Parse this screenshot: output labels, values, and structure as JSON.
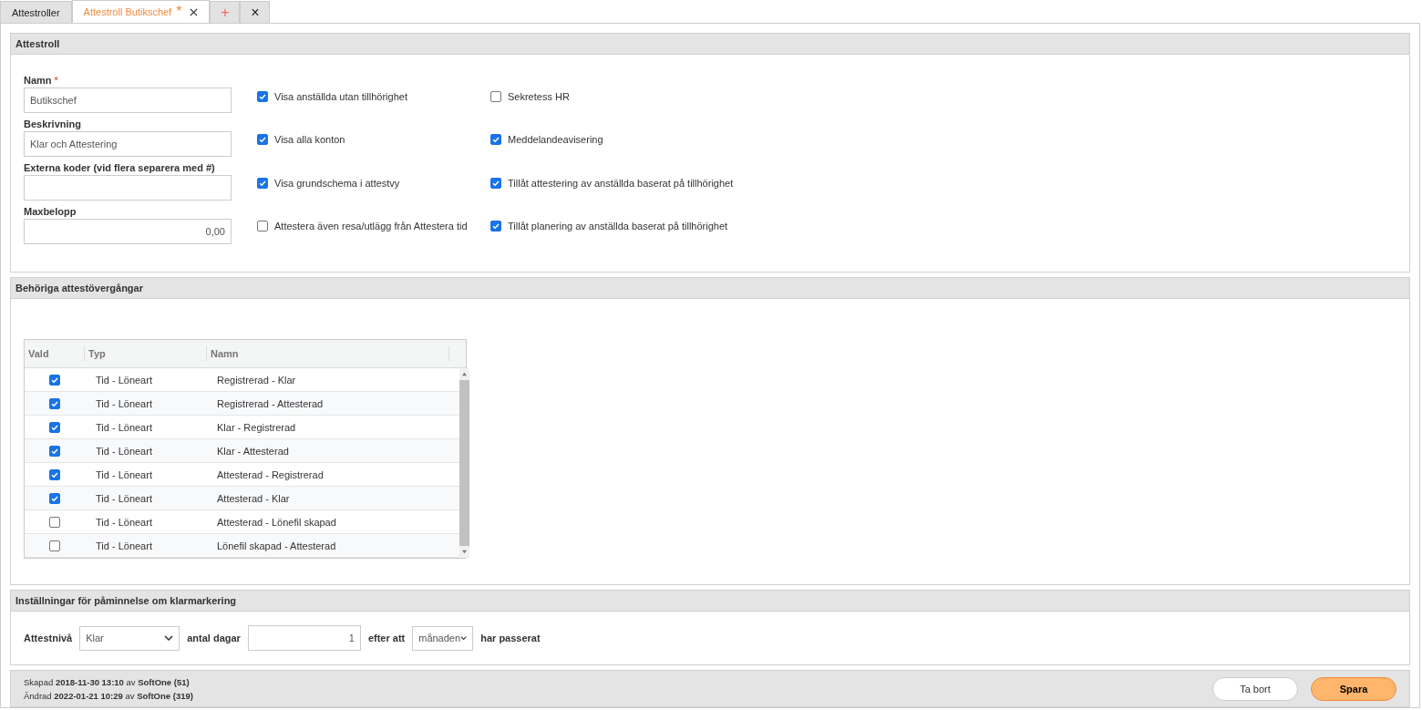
{
  "tabs": [
    {
      "label": "Attestroller",
      "selected": false,
      "kind": "plain"
    },
    {
      "label": "Attestroll Butikschef",
      "selected": true,
      "kind": "edit",
      "modified_mark": "*"
    },
    {
      "label": "+",
      "selected": false,
      "kind": "add"
    },
    {
      "label": "×",
      "selected": false,
      "kind": "closeall"
    }
  ],
  "role_section": {
    "title": "Attestroll",
    "fields": [
      {
        "label": "Namn",
        "required_mark": "*",
        "value": "Butikschef",
        "kind": "text"
      },
      {
        "label": "Beskrivning",
        "value": "Klar och Attestering",
        "kind": "text"
      },
      {
        "label": "Externa koder (vid flera separera med #)",
        "kind": "text"
      },
      {
        "label": "Maxbelopp",
        "value": "0,00",
        "kind": "number"
      }
    ],
    "options_column_1": [
      {
        "label": "Visa anställda utan tillhörighet",
        "checked": true
      },
      {
        "label": "Visa alla konton",
        "checked": true
      },
      {
        "label": "Visa grundschema i attestvy",
        "checked": true
      },
      {
        "label": "Attestera även resa/utlägg från Attestera tid",
        "checked": false
      }
    ],
    "options_column_2": [
      {
        "label": "Sekretess HR",
        "checked": false
      },
      {
        "label": "Meddelandeavisering",
        "checked": true
      },
      {
        "label": "Tillåt attestering av anställda baserat på tillhörighet",
        "checked": true
      },
      {
        "label": "Tillåt planering av anställda baserat på tillhörighet",
        "checked": true
      }
    ]
  },
  "transitions_section": {
    "title": "Behöriga attestövergångar",
    "table": {
      "columns": [
        "Vald",
        "Typ",
        "Namn"
      ],
      "rows": [
        {
          "checked": true,
          "type": "Tid - Löneart",
          "name": "Registrerad - Klar"
        },
        {
          "checked": true,
          "type": "Tid - Löneart",
          "name": "Registrerad - Attesterad"
        },
        {
          "checked": true,
          "type": "Tid - Löneart",
          "name": "Klar - Registrerad"
        },
        {
          "checked": true,
          "type": "Tid - Löneart",
          "name": "Klar - Attesterad"
        },
        {
          "checked": true,
          "type": "Tid - Löneart",
          "name": "Attesterad - Registrerad"
        },
        {
          "checked": true,
          "type": "Tid - Löneart",
          "name": "Attesterad - Klar"
        },
        {
          "checked": false,
          "type": "Tid - Löneart",
          "name": "Attesterad - Lönefil skapad"
        },
        {
          "checked": false,
          "type": "Tid - Löneart",
          "name": "Lönefil skapad - Attesterad"
        }
      ]
    }
  },
  "reminder_section": {
    "title": "Inställningar för påminnelse om klarmarkering",
    "level_label": "Attestnivå",
    "level_value": "Klar",
    "days_label": "antal dagar",
    "days_value": "1",
    "after_label": "efter att",
    "period_value": "månaden",
    "passed_label": "har passerat"
  },
  "footer": {
    "created": "Skapad **2018-11-30 13:10** av **SoftOne (51)**",
    "changed": "Ändrad **2022-01-21 10:29** av **SoftOne (319)**",
    "buttons": [
      {
        "label": "Ta bort",
        "kind": "secondary"
      },
      {
        "label": "Spara",
        "kind": "primary"
      }
    ]
  }
}
